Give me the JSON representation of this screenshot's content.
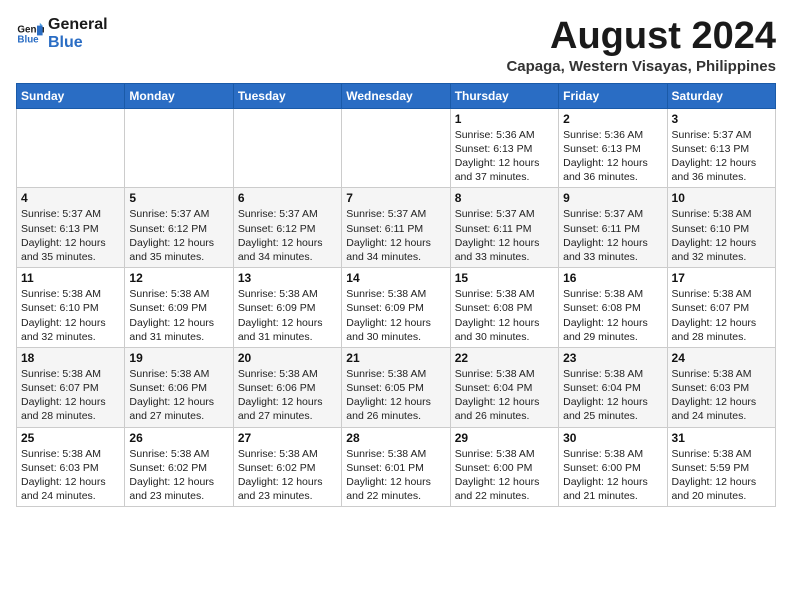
{
  "logo": {
    "line1": "General",
    "line2": "Blue"
  },
  "title": "August 2024",
  "subtitle": "Capaga, Western Visayas, Philippines",
  "weekdays": [
    "Sunday",
    "Monday",
    "Tuesday",
    "Wednesday",
    "Thursday",
    "Friday",
    "Saturday"
  ],
  "weeks": [
    [
      {
        "day": "",
        "info": ""
      },
      {
        "day": "",
        "info": ""
      },
      {
        "day": "",
        "info": ""
      },
      {
        "day": "",
        "info": ""
      },
      {
        "day": "1",
        "info": "Sunrise: 5:36 AM\nSunset: 6:13 PM\nDaylight: 12 hours\nand 37 minutes."
      },
      {
        "day": "2",
        "info": "Sunrise: 5:36 AM\nSunset: 6:13 PM\nDaylight: 12 hours\nand 36 minutes."
      },
      {
        "day": "3",
        "info": "Sunrise: 5:37 AM\nSunset: 6:13 PM\nDaylight: 12 hours\nand 36 minutes."
      }
    ],
    [
      {
        "day": "4",
        "info": "Sunrise: 5:37 AM\nSunset: 6:13 PM\nDaylight: 12 hours\nand 35 minutes."
      },
      {
        "day": "5",
        "info": "Sunrise: 5:37 AM\nSunset: 6:12 PM\nDaylight: 12 hours\nand 35 minutes."
      },
      {
        "day": "6",
        "info": "Sunrise: 5:37 AM\nSunset: 6:12 PM\nDaylight: 12 hours\nand 34 minutes."
      },
      {
        "day": "7",
        "info": "Sunrise: 5:37 AM\nSunset: 6:11 PM\nDaylight: 12 hours\nand 34 minutes."
      },
      {
        "day": "8",
        "info": "Sunrise: 5:37 AM\nSunset: 6:11 PM\nDaylight: 12 hours\nand 33 minutes."
      },
      {
        "day": "9",
        "info": "Sunrise: 5:37 AM\nSunset: 6:11 PM\nDaylight: 12 hours\nand 33 minutes."
      },
      {
        "day": "10",
        "info": "Sunrise: 5:38 AM\nSunset: 6:10 PM\nDaylight: 12 hours\nand 32 minutes."
      }
    ],
    [
      {
        "day": "11",
        "info": "Sunrise: 5:38 AM\nSunset: 6:10 PM\nDaylight: 12 hours\nand 32 minutes."
      },
      {
        "day": "12",
        "info": "Sunrise: 5:38 AM\nSunset: 6:09 PM\nDaylight: 12 hours\nand 31 minutes."
      },
      {
        "day": "13",
        "info": "Sunrise: 5:38 AM\nSunset: 6:09 PM\nDaylight: 12 hours\nand 31 minutes."
      },
      {
        "day": "14",
        "info": "Sunrise: 5:38 AM\nSunset: 6:09 PM\nDaylight: 12 hours\nand 30 minutes."
      },
      {
        "day": "15",
        "info": "Sunrise: 5:38 AM\nSunset: 6:08 PM\nDaylight: 12 hours\nand 30 minutes."
      },
      {
        "day": "16",
        "info": "Sunrise: 5:38 AM\nSunset: 6:08 PM\nDaylight: 12 hours\nand 29 minutes."
      },
      {
        "day": "17",
        "info": "Sunrise: 5:38 AM\nSunset: 6:07 PM\nDaylight: 12 hours\nand 28 minutes."
      }
    ],
    [
      {
        "day": "18",
        "info": "Sunrise: 5:38 AM\nSunset: 6:07 PM\nDaylight: 12 hours\nand 28 minutes."
      },
      {
        "day": "19",
        "info": "Sunrise: 5:38 AM\nSunset: 6:06 PM\nDaylight: 12 hours\nand 27 minutes."
      },
      {
        "day": "20",
        "info": "Sunrise: 5:38 AM\nSunset: 6:06 PM\nDaylight: 12 hours\nand 27 minutes."
      },
      {
        "day": "21",
        "info": "Sunrise: 5:38 AM\nSunset: 6:05 PM\nDaylight: 12 hours\nand 26 minutes."
      },
      {
        "day": "22",
        "info": "Sunrise: 5:38 AM\nSunset: 6:04 PM\nDaylight: 12 hours\nand 26 minutes."
      },
      {
        "day": "23",
        "info": "Sunrise: 5:38 AM\nSunset: 6:04 PM\nDaylight: 12 hours\nand 25 minutes."
      },
      {
        "day": "24",
        "info": "Sunrise: 5:38 AM\nSunset: 6:03 PM\nDaylight: 12 hours\nand 24 minutes."
      }
    ],
    [
      {
        "day": "25",
        "info": "Sunrise: 5:38 AM\nSunset: 6:03 PM\nDaylight: 12 hours\nand 24 minutes."
      },
      {
        "day": "26",
        "info": "Sunrise: 5:38 AM\nSunset: 6:02 PM\nDaylight: 12 hours\nand 23 minutes."
      },
      {
        "day": "27",
        "info": "Sunrise: 5:38 AM\nSunset: 6:02 PM\nDaylight: 12 hours\nand 23 minutes."
      },
      {
        "day": "28",
        "info": "Sunrise: 5:38 AM\nSunset: 6:01 PM\nDaylight: 12 hours\nand 22 minutes."
      },
      {
        "day": "29",
        "info": "Sunrise: 5:38 AM\nSunset: 6:00 PM\nDaylight: 12 hours\nand 22 minutes."
      },
      {
        "day": "30",
        "info": "Sunrise: 5:38 AM\nSunset: 6:00 PM\nDaylight: 12 hours\nand 21 minutes."
      },
      {
        "day": "31",
        "info": "Sunrise: 5:38 AM\nSunset: 5:59 PM\nDaylight: 12 hours\nand 20 minutes."
      }
    ]
  ]
}
